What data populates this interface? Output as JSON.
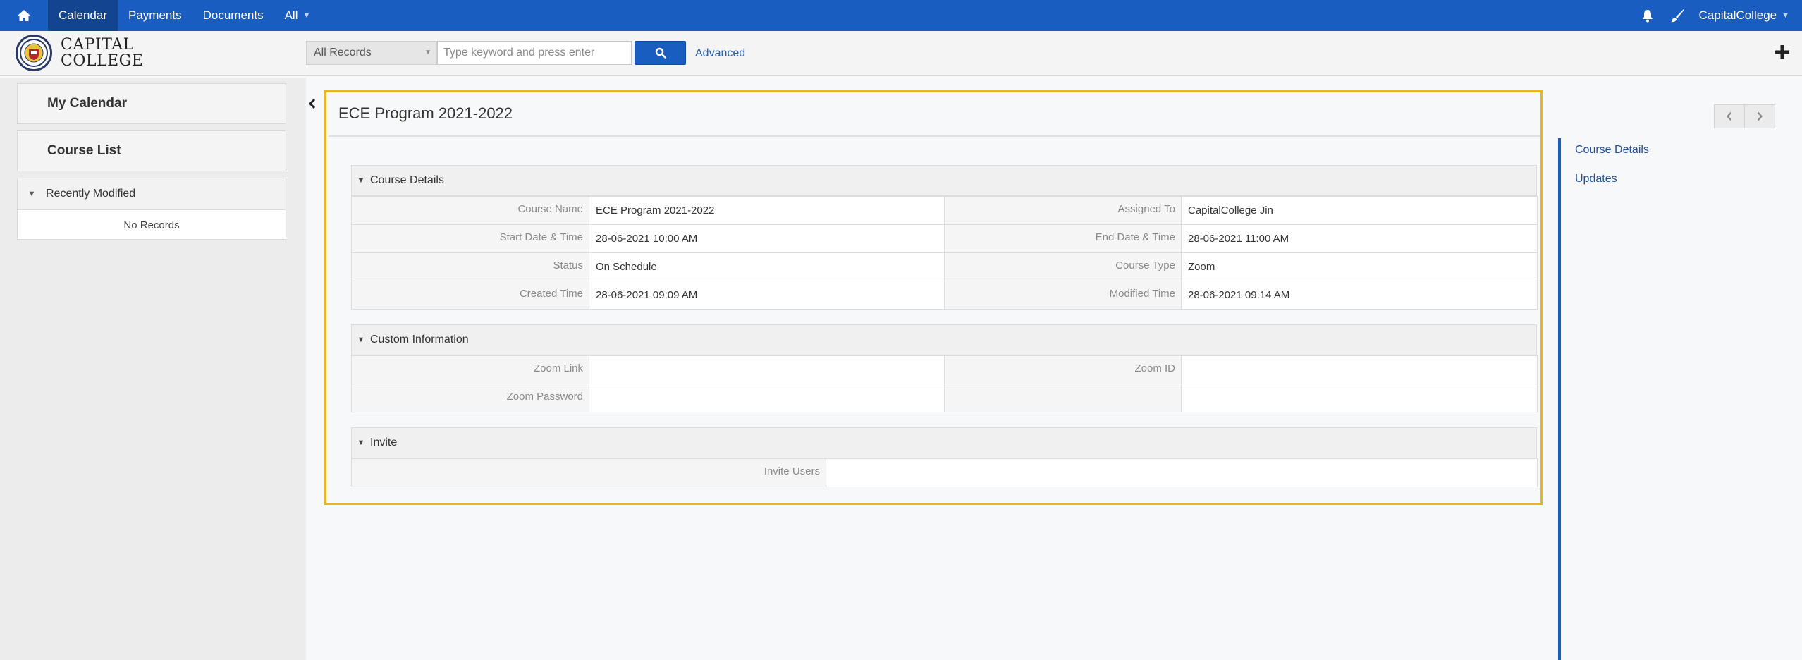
{
  "topnav": {
    "items": [
      {
        "label": "Calendar",
        "active": true
      },
      {
        "label": "Payments",
        "active": false
      },
      {
        "label": "Documents",
        "active": false
      },
      {
        "label": "All",
        "active": false
      }
    ],
    "user": "CapitalCollege",
    "icons": [
      "home-icon",
      "bell-icon",
      "paintbrush-icon",
      "chevron-down-icon"
    ],
    "color": "#1a5dc0"
  },
  "header": {
    "logo_line1": "CAPITAL",
    "logo_line2": "COLLEGE",
    "search_scope": "All Records",
    "search_placeholder": "Type keyword and press enter",
    "advanced_label": "Advanced"
  },
  "sidebar": {
    "my_calendar": "My Calendar",
    "course_list": "Course List",
    "recently_modified": "Recently Modified",
    "no_records": "No Records"
  },
  "record": {
    "title": "ECE Program 2021-2022",
    "blocks": {
      "course_details": {
        "title": "Course Details",
        "rows": [
          {
            "l1": "Course Name",
            "v1": "ECE Program 2021-2022",
            "l2": "Assigned To",
            "v2": "CapitalCollege Jin"
          },
          {
            "l1": "Start Date & Time",
            "v1": "28-06-2021 10:00 AM",
            "l2": "End Date & Time",
            "v2": "28-06-2021 11:00 AM"
          },
          {
            "l1": "Status",
            "v1": "On Schedule",
            "l2": "Course Type",
            "v2": "Zoom"
          },
          {
            "l1": "Created Time",
            "v1": "28-06-2021 09:09 AM",
            "l2": "Modified Time",
            "v2": "28-06-2021 09:14 AM"
          }
        ]
      },
      "custom_information": {
        "title": "Custom Information",
        "rows": [
          {
            "l1": "Zoom Link",
            "v1": "",
            "l2": "Zoom ID",
            "v2": ""
          },
          {
            "l1": "Zoom Password",
            "v1": "",
            "l2": "",
            "v2": ""
          }
        ]
      },
      "invite": {
        "title": "Invite",
        "label": "Invite Users",
        "value": ""
      }
    }
  },
  "rightpanel": {
    "links": [
      "Course Details",
      "Updates"
    ]
  }
}
